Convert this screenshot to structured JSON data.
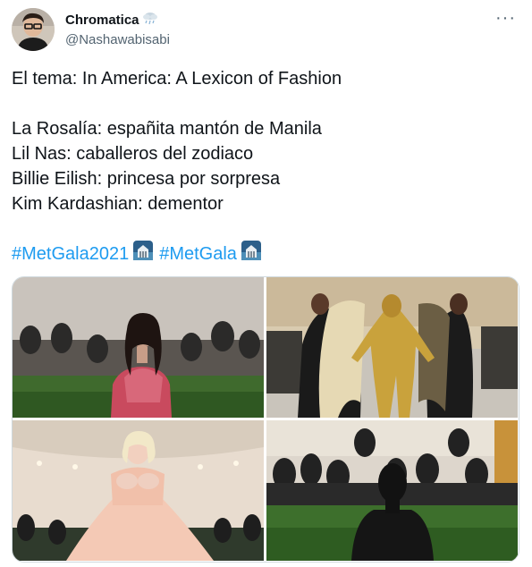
{
  "user": {
    "display_name": "Chromatica",
    "handle": "@Nashawabisabi",
    "badge_icon": "cloud-emoji-icon",
    "avatar_icon": "avatar-photo"
  },
  "tweet": {
    "line1": "El tema: In America: A Lexicon of Fashion",
    "line2": "La Rosalía: españita mantón de Manila",
    "line3": "Lil Nas: caballeros del zodiaco",
    "line4": "Billie Eilish: princesa por sorpresa",
    "line5": "Kim Kardashian: dementor",
    "hashtag1": "#MetGala2021",
    "hashtag2": "#MetGala",
    "hashtag_emoji": "met-gala-hashflag-icon",
    "link_color": "#1d9bf0"
  },
  "media": {
    "photos": [
      "rosalia-photo",
      "lil-nas-photo",
      "billie-eilish-photo",
      "kim-kardashian-photo"
    ]
  },
  "more_icon": "more-options-icon"
}
